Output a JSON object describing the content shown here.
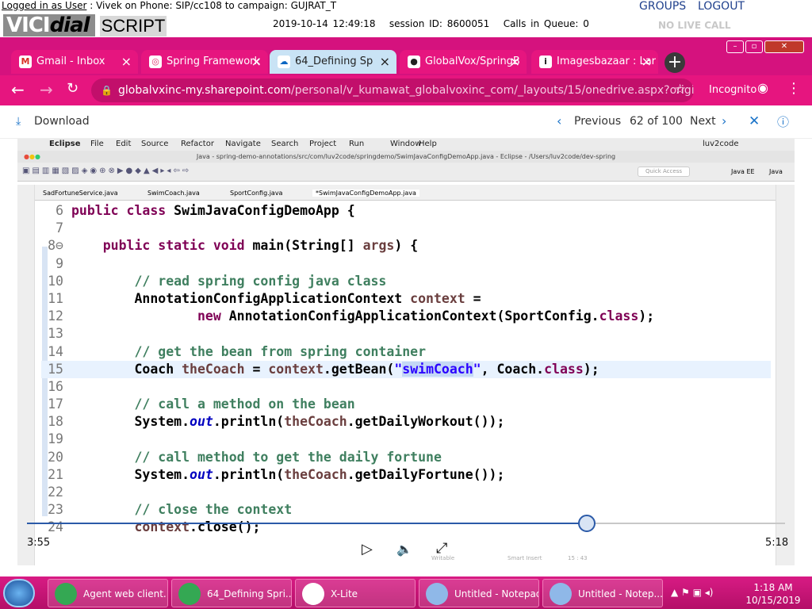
{
  "vicidial": {
    "login_prefix": "Logged in as User",
    "login_rest": " : Vivek on Phone: SIP/cc108  to campaign: GUJRAT_T",
    "logo_a": "VICI",
    "logo_b": "dial",
    "script_tab": "SCRIPT",
    "datetime": "2019-10-14 12:49:18",
    "session": "session ID: 8600051",
    "queue": "Calls in Queue: 0",
    "groups": "GROUPS",
    "logout": "LOGOUT",
    "no_live_call": "NO LIVE CALL"
  },
  "browser": {
    "tabs": [
      {
        "label": "Gmail - Inbox",
        "icon": "M",
        "color": "#d93025"
      },
      {
        "label": "Spring Framework",
        "icon": "◎",
        "color": "#e1306c"
      },
      {
        "label": "64_Defining Sp",
        "icon": "☁",
        "color": "#0a66c2"
      },
      {
        "label": "GlobalVox/SpringB",
        "icon": "●",
        "color": "#222222"
      },
      {
        "label": "Imagesbazaar : Lar",
        "icon": "i",
        "color": "#222222"
      }
    ],
    "url_host": "globalvxinc-my.sharepoint.com",
    "url_path": "/personal/v_kumawat_globalvoxinc_com/_layouts/15/onedrive.aspx?originalPa...",
    "incognito": "Incognito"
  },
  "viewer": {
    "download": "Download",
    "previous": "Previous",
    "counter": "62 of 100",
    "next": "Next"
  },
  "eclipse": {
    "menu": [
      "Eclipse",
      "File",
      "Edit",
      "Source",
      "Refactor",
      "Navigate",
      "Search",
      "Project",
      "Run",
      "Window",
      "Help"
    ],
    "menu_user": "luv2code",
    "title": "Java - spring-demo-annotations/src/com/luv2code/springdemo/SwimJavaConfigDemoApp.java - Eclipse - /Users/luv2code/dev-spring",
    "quick_access": "Quick Access",
    "perspective_ee": "Java EE",
    "perspective_java": "Java",
    "editor_tabs": [
      "SadFortuneService.java",
      "SwimCoach.java",
      "SportConfig.java",
      "*SwimJavaConfigDemoApp.java"
    ],
    "status_writable": "Writable",
    "status_insert": "Smart Insert",
    "status_pos": "15 : 43"
  },
  "code_lines": [
    {
      "n": "6",
      "html": "<span class='kw'>public class</span> SwimJavaConfigDemoApp {"
    },
    {
      "n": "7",
      "html": ""
    },
    {
      "n": "8⊖",
      "html": "    <span class='kw'>public static void</span> main(String[] <span class='var'>args</span>) {"
    },
    {
      "n": "9",
      "html": ""
    },
    {
      "n": "10",
      "html": "        <span class='cm'>// read spring config java class</span>"
    },
    {
      "n": "11",
      "html": "        AnnotationConfigApplicationContext <span class='var'>context</span> ="
    },
    {
      "n": "12",
      "html": "                <span class='kw'>new</span> AnnotationConfigApplicationContext(SportConfig.<span class='kw'>class</span>);"
    },
    {
      "n": "13",
      "html": ""
    },
    {
      "n": "14",
      "html": "        <span class='cm'>// get the bean from spring container</span>"
    },
    {
      "n": "15",
      "html": "        Coach <span class='var'>theCoach</span> = <span class='var'>context</span>.getBean(<span class='st'>\"<span class='sel'>swimCoach</span>\"</span>, Coach.<span class='kw'>class</span>);",
      "current": true
    },
    {
      "n": "16",
      "html": ""
    },
    {
      "n": "17",
      "html": "        <span class='cm'>// call a method on the bean</span>"
    },
    {
      "n": "18",
      "html": "        System.<span class='fld'>out</span>.println(<span class='var'>theCoach</span>.getDailyWorkout());"
    },
    {
      "n": "19",
      "html": ""
    },
    {
      "n": "20",
      "html": "        <span class='cm'>// call method to get the daily fortune</span>"
    },
    {
      "n": "21",
      "html": "        System.<span class='fld'>out</span>.println(<span class='var'>theCoach</span>.getDailyFortune());"
    },
    {
      "n": "22",
      "html": ""
    },
    {
      "n": "23",
      "html": "        <span class='cm'>// close the context</span>"
    },
    {
      "n": "24",
      "html": "        <span class='var'>context</span>.close();"
    }
  ],
  "player": {
    "elapsed": "3:55",
    "duration": "5:18",
    "progress_fraction": 0.739
  },
  "taskbar": {
    "items": [
      {
        "label": "Agent web client...",
        "icon_color": "#34a853"
      },
      {
        "label": "64_Defining Spri...",
        "icon_color": "#34a853"
      },
      {
        "label": "X-Lite",
        "icon_color": "#ffffff"
      },
      {
        "label": "Untitled - Notepad",
        "icon_color": "#8fb8e8"
      },
      {
        "label": "Untitled - Notep...",
        "icon_color": "#8fb8e8"
      }
    ],
    "time": "1:18 AM",
    "date": "10/15/2019"
  }
}
